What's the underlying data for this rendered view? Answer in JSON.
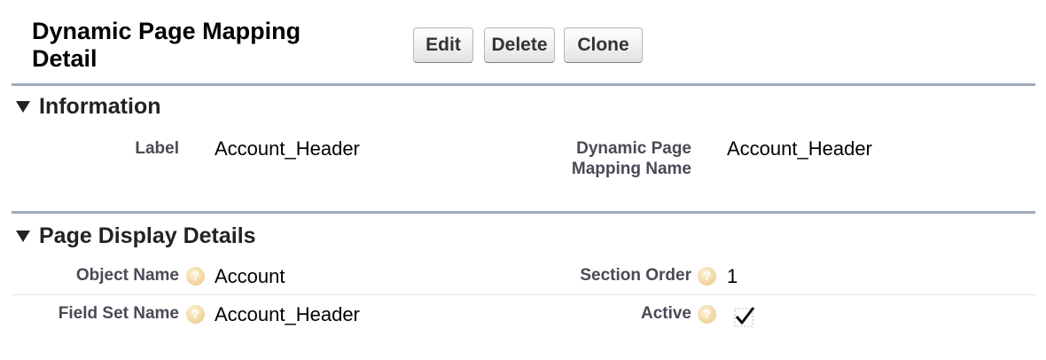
{
  "header": {
    "title": "Dynamic Page Mapping Detail",
    "buttons": {
      "edit": "Edit",
      "delete": "Delete",
      "clone": "Clone"
    }
  },
  "sections": {
    "information": {
      "title": "Information",
      "fields": {
        "label": {
          "label": "Label",
          "value": "Account_Header"
        },
        "mapping_name": {
          "label": "Dynamic Page Mapping Name",
          "value": "Account_Header"
        }
      }
    },
    "page_display": {
      "title": "Page Display Details",
      "fields": {
        "object_name": {
          "label": "Object Name",
          "value": "Account"
        },
        "section_order": {
          "label": "Section Order",
          "value": "1"
        },
        "field_set_name": {
          "label": "Field Set Name",
          "value": "Account_Header"
        },
        "active": {
          "label": "Active",
          "checked": true
        }
      }
    }
  },
  "icons": {
    "help": "help-icon",
    "collapse": "triangle-down-icon",
    "checkmark": "checkmark-icon"
  },
  "colors": {
    "section_rule": "#a1a9bd",
    "label_text": "#4a4a56",
    "help_icon": "#efd39a"
  }
}
